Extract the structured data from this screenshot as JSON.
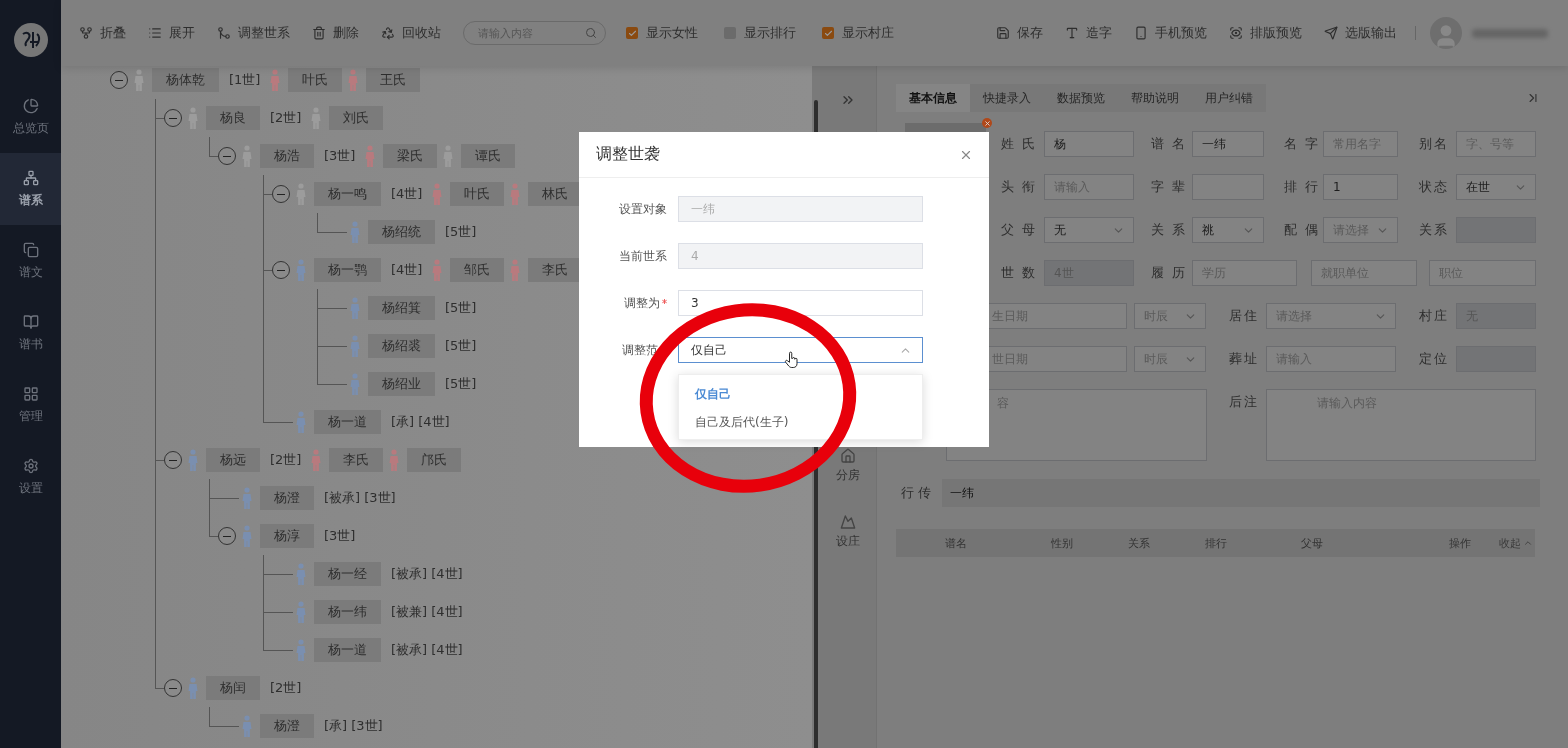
{
  "sidebar": {
    "items": [
      {
        "label": "总览页",
        "selected": false
      },
      {
        "label": "谱系",
        "selected": true
      },
      {
        "label": "谱文",
        "selected": false
      },
      {
        "label": "谱书",
        "selected": false
      },
      {
        "label": "管理",
        "selected": false
      },
      {
        "label": "设置",
        "selected": false
      }
    ]
  },
  "toolbar": {
    "actions": [
      {
        "label": "折叠"
      },
      {
        "label": "展开"
      },
      {
        "label": "调整世系"
      },
      {
        "label": "删除"
      },
      {
        "label": "回收站"
      }
    ],
    "search": {
      "placeholder": "请输入内容"
    },
    "toggles": [
      {
        "label": "显示女性",
        "checked": true
      },
      {
        "label": "显示排行",
        "checked": false
      },
      {
        "label": "显示村庄",
        "checked": true
      }
    ],
    "right_actions": [
      {
        "label": "保存"
      },
      {
        "label": "造字"
      },
      {
        "label": "手机预览"
      },
      {
        "label": "排版预览"
      },
      {
        "label": "选版输出"
      }
    ]
  },
  "tree": {
    "name": "杨体乾",
    "generation": "[1世]",
    "color": "#9c9c9c",
    "expanded": true,
    "spouses": [
      {
        "name": "叶氏",
        "color": "#b87a7e"
      },
      {
        "name": "王氏",
        "color": "#b87a7e"
      }
    ],
    "children": [
      {
        "name": "杨良",
        "generation": "[2世]",
        "color": "#9c9c9c",
        "expanded": true,
        "spouses": [
          {
            "name": "刘氏",
            "color": "#9c9c9c"
          }
        ],
        "children": [
          {
            "name": "杨浩",
            "generation": "[3世]",
            "color": "#9c9c9c",
            "expanded": true,
            "spouses": [
              {
                "name": "梁氏",
                "color": "#b87a7e"
              },
              {
                "name": "谭氏",
                "color": "#9c9c9c"
              }
            ],
            "children": [
              {
                "name": "杨一鸣",
                "generation": "[4世]",
                "color": "#9c9c9c",
                "expanded": true,
                "spouses": [
                  {
                    "name": "叶氏",
                    "color": "#b87a7e"
                  },
                  {
                    "name": "林氏",
                    "color": "#b87a7e"
                  }
                ],
                "children": [
                  {
                    "name": "杨绍统",
                    "generation": "[5世]",
                    "color": "#7a8fb0"
                  }
                ]
              },
              {
                "name": "杨一鹗",
                "generation": "[4世]",
                "color": "#7a8fb0",
                "expanded": true,
                "spouses": [
                  {
                    "name": "邹氏",
                    "color": "#b87a7e"
                  },
                  {
                    "name": "李氏",
                    "color": "#b87a7e"
                  }
                ],
                "children": [
                  {
                    "name": "杨绍箕",
                    "generation": "[5世]",
                    "color": "#7a8fb0"
                  },
                  {
                    "name": "杨绍裘",
                    "generation": "[5世]",
                    "color": "#7a8fb0"
                  },
                  {
                    "name": "杨绍业",
                    "generation": "[5世]",
                    "color": "#7a8fb0"
                  }
                ]
              },
              {
                "name": "杨一道",
                "generation": "[承] [4世]",
                "color": "#7a8fb0"
              }
            ]
          }
        ]
      },
      {
        "name": "杨远",
        "generation": "[2世]",
        "color": "#7a8fb0",
        "expanded": true,
        "spouses": [
          {
            "name": "李氏",
            "color": "#b87a7e"
          },
          {
            "name": "邝氏",
            "color": "#b87a7e"
          }
        ],
        "children": [
          {
            "name": "杨澄",
            "generation": "[被承] [3世]",
            "color": "#7a8fb0"
          },
          {
            "name": "杨淳",
            "generation": "[3世]",
            "color": "#7a8fb0",
            "expanded": true,
            "children": [
              {
                "name": "杨一经",
                "generation": "[被承] [4世]",
                "color": "#7a8fb0"
              },
              {
                "name": "杨一纬",
                "generation": "[被兼] [4世]",
                "color": "#7a8fb0"
              },
              {
                "name": "杨一道",
                "generation": "[被承] [4世]",
                "color": "#7a8fb0"
              }
            ]
          }
        ]
      },
      {
        "name": "杨闰",
        "generation": "[2世]",
        "color": "#7a8fb0",
        "expanded": true,
        "children": [
          {
            "name": "杨澄",
            "generation": "[承] [3世]",
            "color": "#7a8fb0"
          }
        ]
      }
    ]
  },
  "side_tools": [
    {
      "label": "分房"
    },
    {
      "label": "设庄"
    }
  ],
  "tabs": [
    {
      "label": "基本信息",
      "selected": true
    },
    {
      "label": "快捷录入",
      "selected": false
    },
    {
      "label": "数据预览",
      "selected": false
    },
    {
      "label": "帮助说明",
      "selected": false
    },
    {
      "label": "用户纠错",
      "selected": false
    }
  ],
  "form": {
    "rows": [
      [
        {
          "label": "姓氏",
          "controls": [
            {
              "kind": "input",
              "value": "杨",
              "disabled": false
            }
          ]
        },
        {
          "label": "谱名",
          "controls": [
            {
              "kind": "input",
              "value": "一纬",
              "disabled": false
            }
          ]
        },
        {
          "label": "名字",
          "controls": [
            {
              "kind": "input",
              "placeholder": "常用名字",
              "disabled": false
            }
          ]
        },
        {
          "label": "别名",
          "controls": [
            {
              "kind": "input",
              "placeholder": "字、号等",
              "disabled": false
            }
          ]
        }
      ],
      [
        {
          "label": "头衔",
          "controls": [
            {
              "kind": "input",
              "placeholder": "请输入",
              "disabled": false
            }
          ]
        },
        {
          "label": "字辈",
          "controls": [
            {
              "kind": "input",
              "disabled": false
            }
          ]
        },
        {
          "label": "排行",
          "controls": [
            {
              "kind": "input",
              "value": "1",
              "disabled": false
            }
          ]
        },
        {
          "label": "状态",
          "controls": [
            {
              "kind": "select",
              "value": "在世"
            }
          ]
        }
      ],
      [
        {
          "label": "父母",
          "controls": [
            {
              "kind": "select",
              "value": "无"
            }
          ]
        },
        {
          "label": "关系",
          "controls": [
            {
              "kind": "select",
              "value": "祧"
            }
          ]
        },
        {
          "label": "配偶",
          "controls": [
            {
              "kind": "select",
              "placeholder": "请选择"
            }
          ]
        },
        {
          "label": "关系",
          "controls": [
            {
              "kind": "input",
              "disabled": true
            }
          ]
        }
      ],
      [
        {
          "label": "世数",
          "controls": [
            {
              "kind": "input",
              "value": "4世",
              "disabled": true
            }
          ]
        },
        {
          "label": "履历",
          "controls": [
            {
              "kind": "input",
              "placeholder": "学历",
              "disabled": false
            },
            {
              "kind": "input",
              "placeholder": "就职单位",
              "disabled": false
            },
            {
              "kind": "input",
              "placeholder": "职位",
              "disabled": false
            }
          ]
        }
      ],
      [
        {
          "controls": [
            {
              "kind": "input",
              "placeholder": "生日期",
              "disabled": false
            },
            {
              "kind": "select",
              "placeholder": "时辰"
            }
          ]
        },
        {
          "label": "居住",
          "controls": [
            {
              "kind": "select",
              "placeholder": "请选择"
            }
          ]
        },
        {
          "label": "村庄",
          "controls": [
            {
              "kind": "input",
              "value": "无",
              "disabled": true
            }
          ]
        }
      ],
      [
        {
          "controls": [
            {
              "kind": "input",
              "placeholder": "世日期",
              "disabled": false
            },
            {
              "kind": "select",
              "placeholder": "时辰"
            }
          ]
        },
        {
          "label": "葬址",
          "controls": [
            {
              "kind": "input",
              "placeholder": "请输入",
              "disabled": false
            }
          ]
        },
        {
          "label": "定位",
          "controls": [
            {
              "kind": "input",
              "disabled": true
            }
          ]
        }
      ],
      [
        {
          "controls": [
            {
              "kind": "textarea",
              "placeholder": "容"
            }
          ]
        },
        {
          "label": "后注",
          "controls": [
            {
              "kind": "textarea",
              "placeholder": "请输入内容"
            }
          ]
        }
      ]
    ]
  },
  "succession": {
    "label": "行传",
    "value": "一纬"
  },
  "table": {
    "columns": [
      "谱名",
      "性别",
      "关系",
      "排行",
      "父母",
      "操作"
    ],
    "collapse": "收起"
  },
  "modal": {
    "title": "调整世袭",
    "fields": [
      {
        "label": "设置对象",
        "kind": "input",
        "value": "一纬",
        "disabled": true,
        "required": false
      },
      {
        "label": "当前世系",
        "kind": "input",
        "value": "4",
        "disabled": true,
        "required": false
      },
      {
        "label": "调整为",
        "kind": "input",
        "value": "3",
        "disabled": false,
        "required": true
      },
      {
        "label": "调整范",
        "kind": "select",
        "value": "仅自己",
        "open": true,
        "required": false
      }
    ],
    "options": [
      {
        "label": "仅自己",
        "selected": true
      },
      {
        "label": "自己及后代(生子)",
        "selected": false
      }
    ]
  }
}
